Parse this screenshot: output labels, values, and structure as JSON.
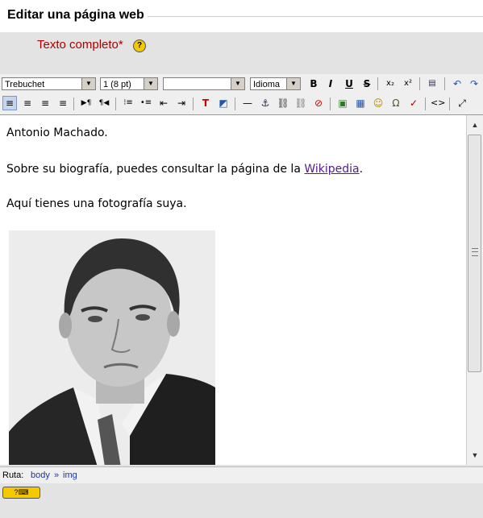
{
  "page": {
    "title": "Editar una página web"
  },
  "field": {
    "label": "Texto completo*",
    "help": "?"
  },
  "toolbar": {
    "font_family": "Trebuchet",
    "font_size": "1 (8 pt)",
    "format": "",
    "language": "Idioma",
    "bold": "B",
    "italic": "I",
    "underline": "U",
    "strike": "S",
    "subscript": "x₂",
    "superscript": "x²",
    "undo": "↶",
    "redo": "↷",
    "align_left": "≡",
    "align_center": "≡",
    "align_right": "≡",
    "justify": "≡",
    "ltr": "▶¶",
    "rtl": "¶◀",
    "ordered_list": "⁝≡",
    "unordered_list": "•≡",
    "outdent": "⇤",
    "indent": "⇥",
    "text_color": "T",
    "bg_color": "◩",
    "hr": "—",
    "anchor": "⚓",
    "link": "⛓",
    "unlink": "⛓",
    "nolink": "⊘",
    "image": "▣",
    "table": "▦",
    "smiley": "☺",
    "special_char": "Ω",
    "spellcheck": "✓",
    "html": "<>",
    "fullscreen": "⤢"
  },
  "editor": {
    "line1": "Antonio Machado.",
    "line2_before": "Sobre su biografía, puedes consultar la página de la",
    "line2_link": "Wikipedia",
    "line2_after": ".",
    "line3": "Aquí tienes una fotografía suya."
  },
  "scrollbar": {
    "up": "▲",
    "down": "▼"
  },
  "status": {
    "label": "Ruta:",
    "path": [
      "body",
      "»",
      "img"
    ]
  },
  "bottom": {
    "help_label": "?⌨"
  }
}
